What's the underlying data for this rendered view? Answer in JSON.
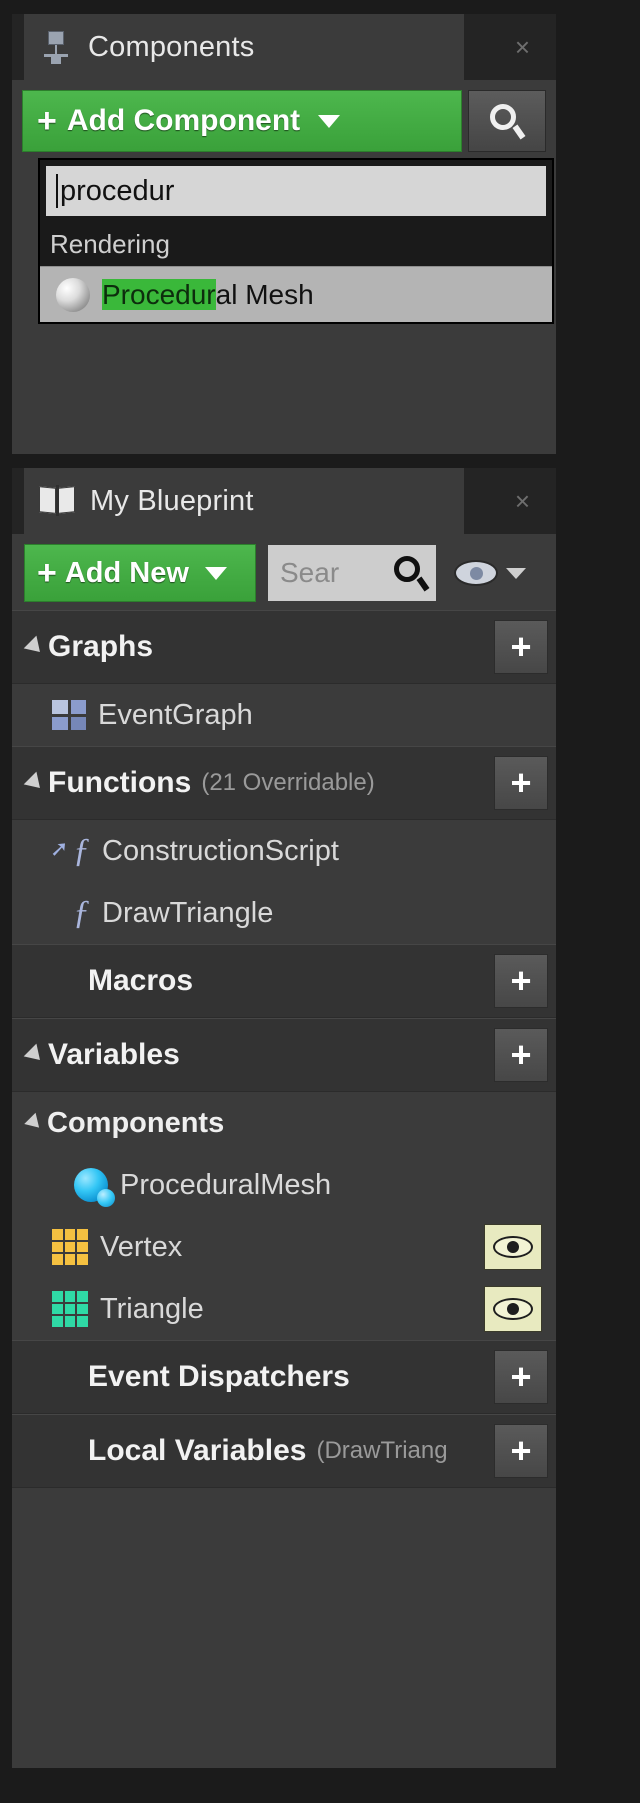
{
  "components_panel": {
    "tab": {
      "title": "Components",
      "icon": "components-icon",
      "close_label": "×"
    },
    "add_component_button": {
      "label": "Add Component",
      "plus": "+",
      "color": "#3aa13a"
    },
    "search_button_icon": "magnifier-icon",
    "dropdown": {
      "search_value": "procedur",
      "category": "Rendering",
      "results": [
        {
          "highlight": "Procedur",
          "rest": "al Mesh",
          "icon": "sphere-icon",
          "selected": true
        }
      ]
    }
  },
  "blueprint_panel": {
    "tab": {
      "title": "My Blueprint",
      "icon": "book-icon",
      "close_label": "×"
    },
    "toolbar": {
      "add_new_label": "Add New",
      "plus": "+",
      "search_placeholder": "Sear",
      "search_icon": "magnifier-icon",
      "eye_icon": "eye-icon",
      "eye_dropdown_icon": "chevron-down-icon"
    },
    "sections": [
      {
        "name": "graphs",
        "title": "Graphs",
        "subtitle": "",
        "has_arrow": true,
        "add_label": "+",
        "items": [
          {
            "label": "EventGraph",
            "icon": "event-graph-icon"
          }
        ]
      },
      {
        "name": "functions",
        "title": "Functions",
        "subtitle": "(21 Overridable)",
        "has_arrow": true,
        "add_label": "+",
        "items": [
          {
            "label": "ConstructionScript",
            "icon": "construction-script-icon"
          },
          {
            "label": "DrawTriangle",
            "icon": "function-icon"
          }
        ]
      },
      {
        "name": "macros",
        "title": "Macros",
        "subtitle": "",
        "has_arrow": false,
        "add_label": "+",
        "items": []
      },
      {
        "name": "variables",
        "title": "Variables",
        "subtitle": "",
        "has_arrow": true,
        "add_label": "+",
        "subgroup": {
          "title": "Components",
          "has_arrow": true,
          "items": [
            {
              "label": "ProceduralMesh",
              "icon": "sphere-icon",
              "eye": false
            }
          ]
        },
        "items": [
          {
            "label": "Vertex",
            "icon": "array-icon-gold",
            "eye": true
          },
          {
            "label": "Triangle",
            "icon": "array-icon-teal",
            "eye": true
          }
        ]
      },
      {
        "name": "event-dispatchers",
        "title": "Event Dispatchers",
        "subtitle": "",
        "has_arrow": false,
        "add_label": "+",
        "items": []
      },
      {
        "name": "local-variables",
        "title": "Local Variables",
        "subtitle": "(DrawTriang",
        "has_arrow": false,
        "add_label": "+",
        "items": []
      }
    ]
  },
  "theme": {
    "accent_green": "#3aa13a",
    "panel_bg": "#3b3b3b",
    "section_bg": "#333333",
    "popup_bg": "#1a1a1a",
    "highlight_green": "#3ab83a",
    "array_gold": "#f5c141",
    "array_teal": "#2fd9a5"
  }
}
